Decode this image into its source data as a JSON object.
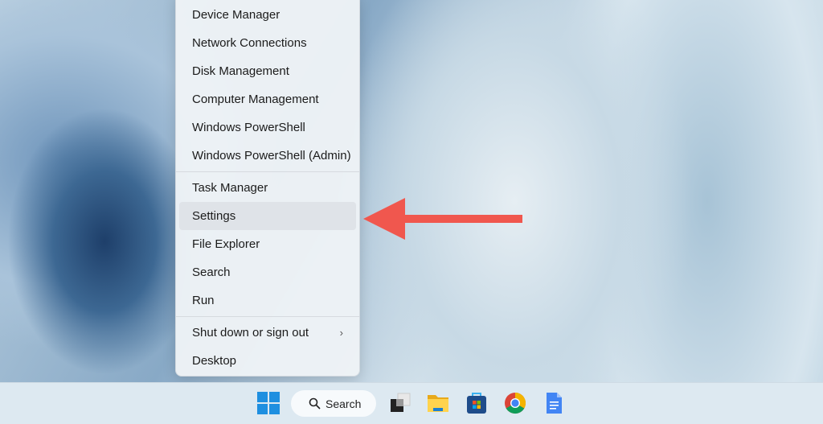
{
  "menu": {
    "items": [
      {
        "label": "Device Manager"
      },
      {
        "label": "Network Connections"
      },
      {
        "label": "Disk Management"
      },
      {
        "label": "Computer Management"
      },
      {
        "label": "Windows PowerShell"
      },
      {
        "label": "Windows PowerShell (Admin)"
      },
      {
        "label": "Task Manager"
      },
      {
        "label": "Settings",
        "highlighted": true
      },
      {
        "label": "File Explorer"
      },
      {
        "label": "Search"
      },
      {
        "label": "Run"
      },
      {
        "label": "Shut down or sign out",
        "submenu_chevron": "›"
      },
      {
        "label": "Desktop"
      }
    ]
  },
  "annotation": {
    "arrow_color": "#f0574e",
    "points_to": "Settings"
  },
  "taskbar": {
    "search_label": "Search",
    "icons": [
      "windows-start-icon",
      "search-icon",
      "task-view-icon",
      "file-explorer-icon",
      "microsoft-store-icon",
      "chrome-icon",
      "google-docs-icon"
    ]
  }
}
